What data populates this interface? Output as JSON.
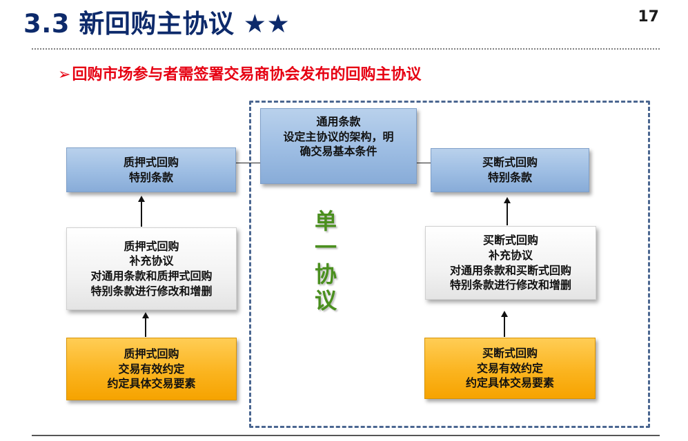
{
  "header": {
    "title": "3.3 新回购主协议 ★★",
    "page_number": "17"
  },
  "subtitle": {
    "bullet": "➢",
    "text": "回购市场参与者需签署交易商协会发布的回购主协议"
  },
  "diagram": {
    "general_terms": {
      "line1": "通用条款",
      "line2": "设定主协议的架构，明",
      "line3": "确交易基本条件"
    },
    "pledge_special": {
      "line1": "质押式回购",
      "line2": "特别条款"
    },
    "outright_special": {
      "line1": "买断式回购",
      "line2": "特别条款"
    },
    "pledge_supplement": {
      "line1": "质押式回购",
      "line2": "补充协议",
      "line3": "对通用条款和质押式回购",
      "line4": "特别条款进行修改和增删"
    },
    "outright_supplement": {
      "line1": "买断式回购",
      "line2": "补充协议",
      "line3": "对通用条款和买断式回购",
      "line4": "特别条款进行修改和增删"
    },
    "pledge_trade": {
      "line1": "质押式回购",
      "line2": "交易有效约定",
      "line3": "约定具体交易要素"
    },
    "outright_trade": {
      "line1": "买断式回购",
      "line2": "交易有效约定",
      "line3": "约定具体交易要素"
    },
    "single_agreement": [
      "单",
      "一",
      "协",
      "议"
    ]
  }
}
